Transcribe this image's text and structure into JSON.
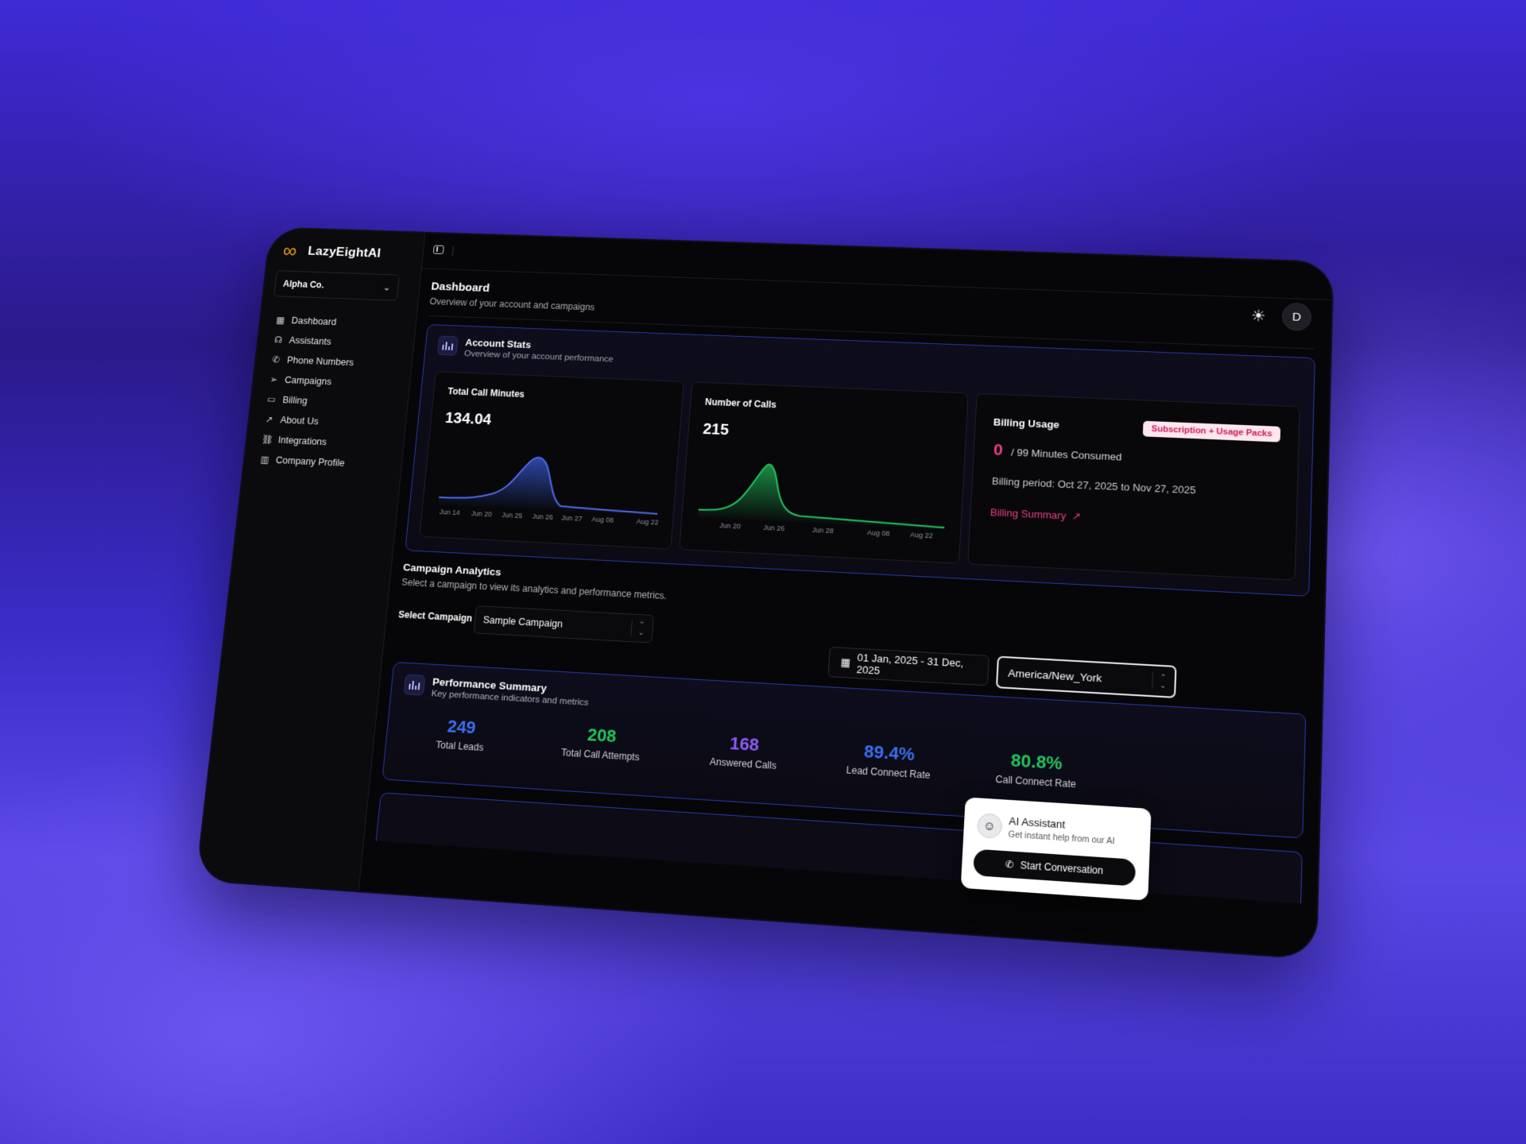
{
  "app": {
    "name": "LazyEightAI",
    "logo_icon": "infinity-icon",
    "accent": "#f59e0b"
  },
  "org_selector": {
    "value": "Alpha Co."
  },
  "sidebar": {
    "items": [
      {
        "label": "Dashboard",
        "icon": "grid-icon"
      },
      {
        "label": "Assistants",
        "icon": "headset-icon"
      },
      {
        "label": "Phone Numbers",
        "icon": "phone-icon"
      },
      {
        "label": "Campaigns",
        "icon": "send-icon"
      },
      {
        "label": "Billing",
        "icon": "card-icon"
      },
      {
        "label": "About Us",
        "icon": "arrow-up-right-icon"
      },
      {
        "label": "Integrations",
        "icon": "link-icon"
      },
      {
        "label": "Company Profile",
        "icon": "building-icon"
      }
    ]
  },
  "header": {
    "title": "Dashboard",
    "subtitle": "Overview of your account and campaigns",
    "avatar_initial": "D"
  },
  "account_stats": {
    "title": "Account Stats",
    "subtitle": "Overview of your account performance",
    "total_call_minutes": {
      "label": "Total Call Minutes",
      "value": "134.04",
      "color": "#3b5bdb",
      "ticks": [
        "Jun 14",
        "Jun 20",
        "Jun 25",
        "Jun 26",
        "Jun 27",
        "Aug 08",
        "Aug 22"
      ]
    },
    "number_of_calls": {
      "label": "Number of Calls",
      "value": "215",
      "color": "#22c55e",
      "ticks": [
        "Jun 20",
        "Jun 26",
        "Jun 28",
        "Aug 08",
        "Aug 22"
      ]
    },
    "billing_usage": {
      "label": "Billing Usage",
      "badge": "Subscription + Usage Packs",
      "consumed": "0",
      "consumed_suffix": "/ 99 Minutes Consumed",
      "period": "Billing period: Oct 27, 2025 to Nov 27, 2025",
      "link": "Billing Summary",
      "accent": "#ec3d86"
    }
  },
  "campaign_analytics": {
    "title": "Campaign Analytics",
    "subtitle": "Select a campaign to view its analytics and performance metrics.",
    "select_label": "Select Campaign",
    "selected_campaign": "Sample Campaign",
    "date_range": "01 Jan, 2025 - 31 Dec, 2025",
    "timezone": "America/New_York"
  },
  "performance_summary": {
    "title": "Performance Summary",
    "subtitle": "Key performance indicators and metrics",
    "metrics": [
      {
        "value": "249",
        "label": "Total Leads",
        "color": "#3b6ff0"
      },
      {
        "value": "208",
        "label": "Total Call Attempts",
        "color": "#22c55e"
      },
      {
        "value": "168",
        "label": "Answered Calls",
        "color": "#8b5cf6"
      },
      {
        "value": "89.4%",
        "label": "Lead Connect Rate",
        "color": "#3b6ff0"
      },
      {
        "value": "80.8%",
        "label": "Call Connect Rate",
        "color": "#22c55e"
      }
    ]
  },
  "assistant_widget": {
    "title": "AI Assistant",
    "subtitle": "Get instant help from our AI",
    "button": "Start Conversation"
  }
}
